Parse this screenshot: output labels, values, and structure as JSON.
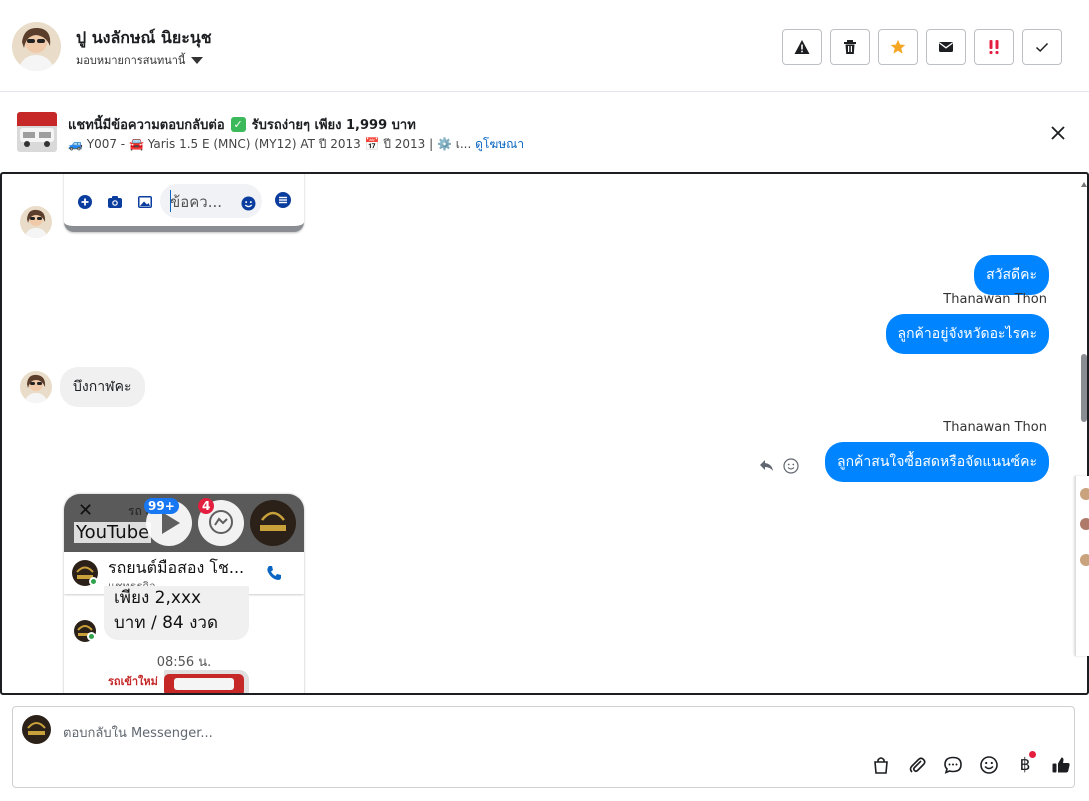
{
  "header": {
    "name": "ปู นงลักษณ์ นิยะนุช",
    "assign_label": "มอบหมายการสนทนานี้",
    "actions": [
      "warning-icon",
      "trash-icon",
      "star-icon",
      "envelope-icon",
      "important-icon",
      "check-icon"
    ],
    "colors": {
      "star": "#f5a623",
      "important": "#e41e3f"
    }
  },
  "ad": {
    "title": "แชทนี้มีข้อความตอบกลับต่อ",
    "check": "✓",
    "title_suffix": "รับรถง่ายๆ เพียง 1,999 บาท",
    "meta": "🚙 Y007 - 🚘 Yaris 1.5 E (MNC) (MY12) AT ปี 2013 📅 ปี 2013 | ⚙️ เ...",
    "link": "ดูโฆษณา"
  },
  "screenshot_top": {
    "input_text": "ข้อคว..."
  },
  "messages": {
    "out1": "สวัสดีคะ",
    "sender1": "Thanawan Thon",
    "out2": "ลูกค้าอยู่จังหวัดอะไรคะ",
    "in1": "บึงกาฬคะ",
    "sender2": "Thanawan Thon",
    "out3": "ลูกค้าสนใจซื้อสดหรือจัดแนนซ์คะ"
  },
  "screenshot_bottom": {
    "close_glyph": "✕",
    "header_partial": "รถ       สอ",
    "youtube_label": "YouTube",
    "badge_count_1": "99+",
    "badge_count_2": "4",
    "contact_name": "รถยนต์มือสอง โช...",
    "contact_type": "แชทธุรกิจ",
    "price_line1": "เพียง 2,xxx",
    "price_line2": "บาท / 84 งวด",
    "time": "08:56 น.",
    "promo_text": "รถเข้าใหม่"
  },
  "composer": {
    "placeholder": "ตอบกลับใน Messenger...",
    "tools": [
      "bag-icon",
      "paperclip-icon",
      "chat-bubble-icon",
      "smile-icon",
      "baht-icon",
      "thumbs-up-icon"
    ],
    "baht_glyph": "฿"
  },
  "colors": {
    "accent": "#0084ff",
    "link": "#0a66c2",
    "bubble_in": "#f0f0f0"
  }
}
